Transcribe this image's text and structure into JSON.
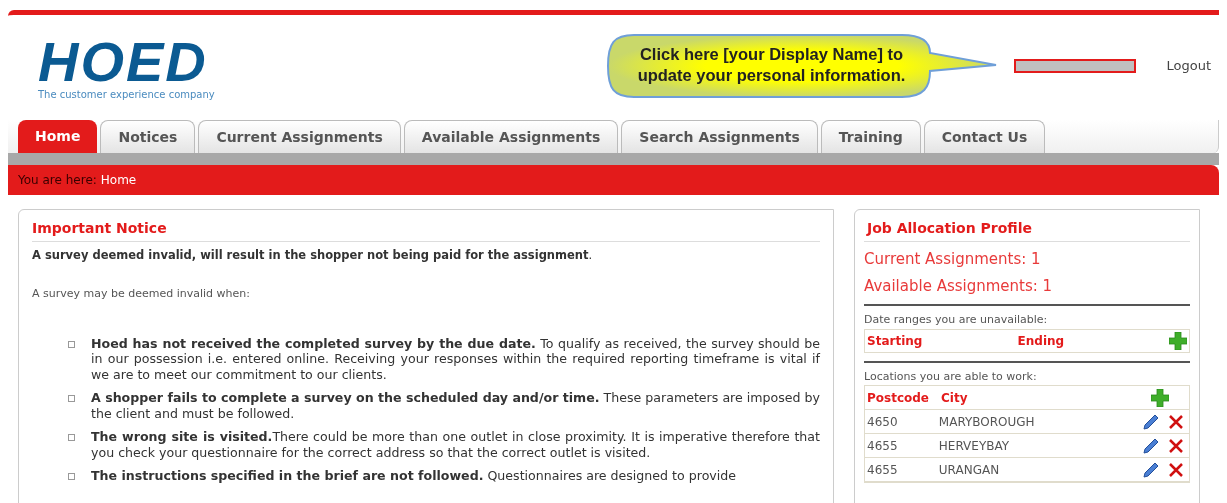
{
  "header": {
    "logo": "HOED",
    "tagline": "The customer experience company",
    "callout": "Click here [your Display Name] to update your personal information.",
    "logout": "Logout"
  },
  "tabs": [
    {
      "label": "Home",
      "selected": true
    },
    {
      "label": "Notices",
      "selected": false
    },
    {
      "label": "Current Assignments",
      "selected": false
    },
    {
      "label": "Available Assignments",
      "selected": false
    },
    {
      "label": "Search Assignments",
      "selected": false
    },
    {
      "label": "Training",
      "selected": false
    },
    {
      "label": "Contact Us",
      "selected": false
    }
  ],
  "breadcrumb": {
    "prefix": "You are here:",
    "current": "Home"
  },
  "notice": {
    "title": "Important Notice",
    "lead": "**A survey deemed invalid, will result in the shopper not being paid for the assignment**.",
    "intro": "A survey may be deemed invalid when:",
    "items": [
      "**Hoed has not received the completed survey by the due date.** To qualify as received, the survey should be in our possession i.e. entered online. Receiving your responses within the required reporting timeframe is vital if we are to meet our commitment to our clients.",
      "**A shopper fails to complete a survey on the scheduled day and/or time.** These parameters are imposed by the client and must be followed.",
      "**The wrong site is visited.**There could be more than one outlet in close proximity. It is imperative therefore that you check your questionnaire for the correct address so that the correct outlet is visited.",
      "**The instructions specified in the brief are not followed.** Questionnaires are designed to provide"
    ]
  },
  "profile": {
    "title": "Job Allocation Profile",
    "counts": [
      "Current Assignments: 1",
      "Available Assignments: 1"
    ],
    "unavailable": {
      "caption": "Date ranges you are unavailable:",
      "columns": [
        "Starting",
        "Ending"
      ]
    },
    "locations": {
      "caption": "Locations you are able to work:",
      "columns": [
        "Postcode",
        "City"
      ],
      "rows": [
        {
          "postcode": "4650",
          "city": "MARYBOROUGH"
        },
        {
          "postcode": "4655",
          "city": "HERVEYBAY"
        },
        {
          "postcode": "4655",
          "city": "URANGAN"
        }
      ]
    }
  }
}
